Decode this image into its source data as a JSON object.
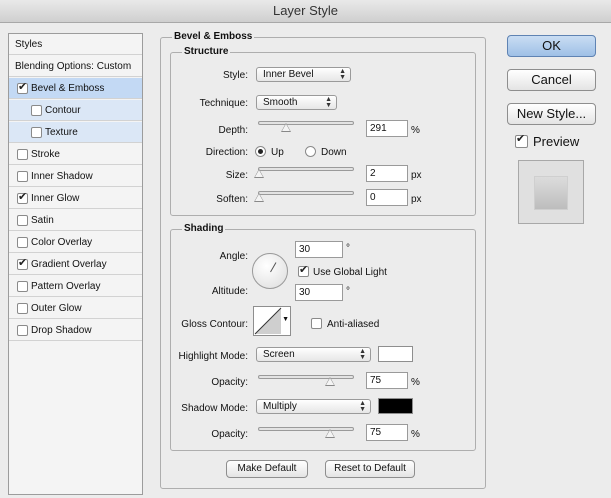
{
  "window": {
    "title": "Layer Style"
  },
  "style_list": {
    "styles_header": "Styles",
    "blending_options": "Blending Options: Custom",
    "items": [
      {
        "label": "Bevel & Emboss",
        "checked": true
      },
      {
        "label": "Contour",
        "checked": false
      },
      {
        "label": "Texture",
        "checked": false
      },
      {
        "label": "Stroke",
        "checked": false
      },
      {
        "label": "Inner Shadow",
        "checked": false
      },
      {
        "label": "Inner Glow",
        "checked": true
      },
      {
        "label": "Satin",
        "checked": false
      },
      {
        "label": "Color Overlay",
        "checked": false
      },
      {
        "label": "Gradient Overlay",
        "checked": true
      },
      {
        "label": "Pattern Overlay",
        "checked": false
      },
      {
        "label": "Outer Glow",
        "checked": false
      },
      {
        "label": "Drop Shadow",
        "checked": false
      }
    ]
  },
  "bevel": {
    "title": "Bevel & Emboss",
    "structure": {
      "title": "Structure",
      "style_label": "Style:",
      "style_value": "Inner Bevel",
      "technique_label": "Technique:",
      "technique_value": "Smooth",
      "depth_label": "Depth:",
      "depth_value": "291",
      "depth_unit": "%",
      "direction_label": "Direction:",
      "direction_up": "Up",
      "direction_down": "Down",
      "size_label": "Size:",
      "size_value": "2",
      "size_unit": "px",
      "soften_label": "Soften:",
      "soften_value": "0",
      "soften_unit": "px"
    },
    "shading": {
      "title": "Shading",
      "angle_label": "Angle:",
      "angle_value": "30",
      "angle_unit": "°",
      "use_global_light": "Use Global Light",
      "altitude_label": "Altitude:",
      "altitude_value": "30",
      "altitude_unit": "°",
      "gloss_contour_label": "Gloss Contour:",
      "anti_aliased": "Anti-aliased",
      "highlight_mode_label": "Highlight Mode:",
      "highlight_mode_value": "Screen",
      "highlight_color": "#ffffff",
      "highlight_opacity_label": "Opacity:",
      "highlight_opacity_value": "75",
      "highlight_opacity_unit": "%",
      "shadow_mode_label": "Shadow Mode:",
      "shadow_mode_value": "Multiply",
      "shadow_color": "#000000",
      "shadow_opacity_label": "Opacity:",
      "shadow_opacity_value": "75",
      "shadow_opacity_unit": "%"
    },
    "make_default": "Make Default",
    "reset_default": "Reset to Default"
  },
  "actions": {
    "ok": "OK",
    "cancel": "Cancel",
    "new_style": "New Style...",
    "preview": "Preview"
  }
}
